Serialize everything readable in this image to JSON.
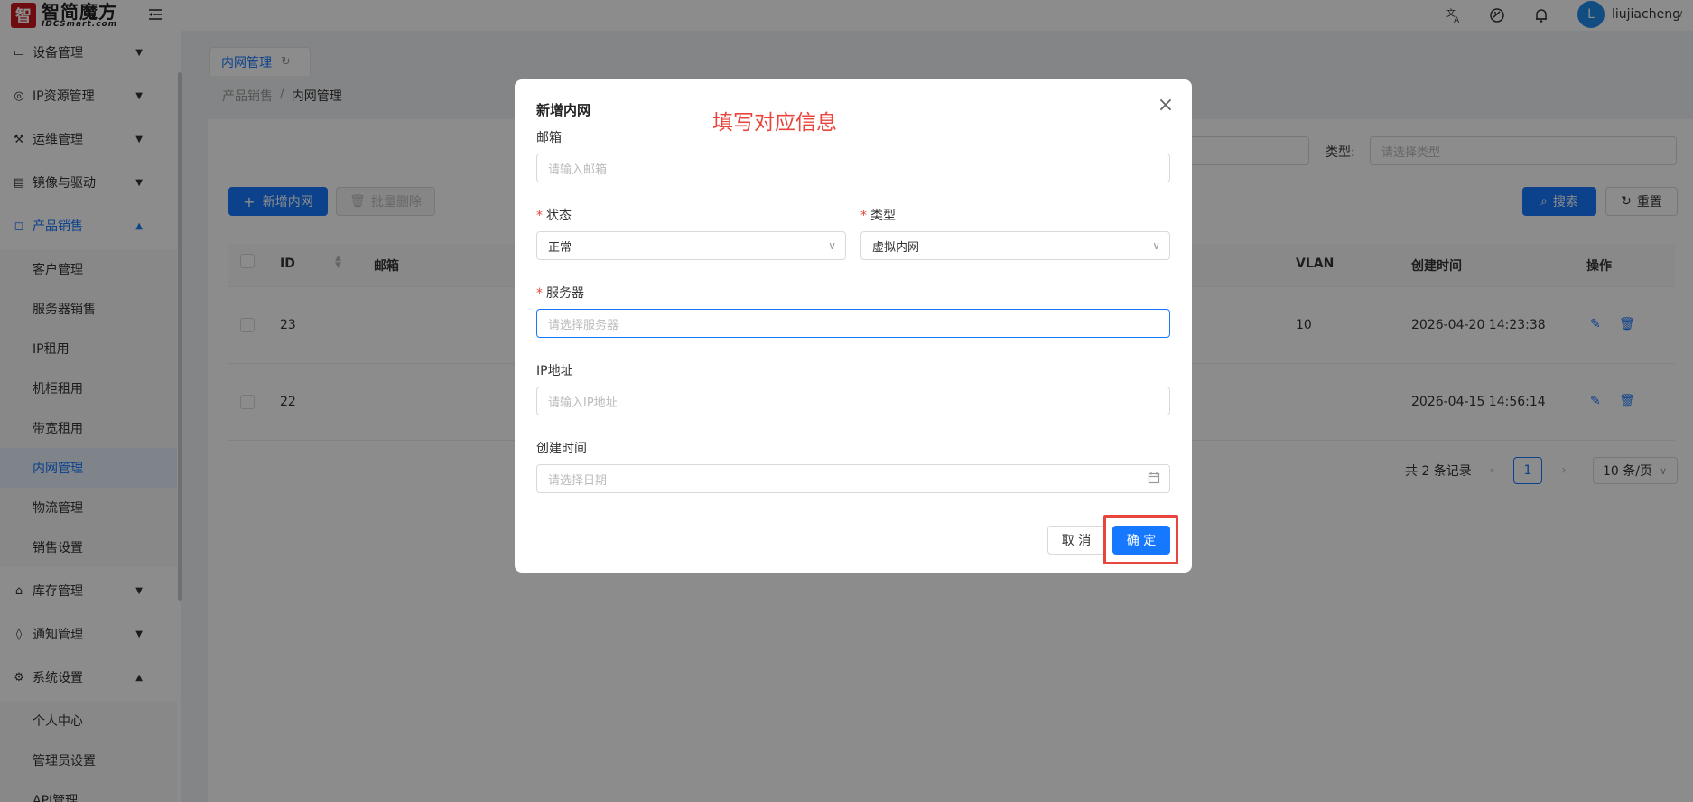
{
  "logo": {
    "mark": "智",
    "cn": "智简魔方",
    "en": "IDCSmart.com"
  },
  "header": {
    "avatar_letter": "L",
    "username": "liujiacheng"
  },
  "sidebar": {
    "items": [
      {
        "label": "设备管理"
      },
      {
        "label": "IP资源管理"
      },
      {
        "label": "运维管理"
      },
      {
        "label": "镜像与驱动"
      },
      {
        "label": "产品销售"
      },
      {
        "label": "库存管理"
      },
      {
        "label": "通知管理"
      },
      {
        "label": "系统设置"
      }
    ],
    "product_sub": [
      "客户管理",
      "服务器销售",
      "IP租用",
      "机柜租用",
      "带宽租用",
      "内网管理",
      "物流管理",
      "销售设置"
    ],
    "system_sub": [
      "个人中心",
      "管理员设置",
      "API管理"
    ]
  },
  "tab": {
    "label": "内网管理"
  },
  "breadcrumb": {
    "parent": "产品销售",
    "sep": "/",
    "current": "内网管理"
  },
  "filters": {
    "type_label": "类型:",
    "type_placeholder": "请选择类型",
    "search": "搜索",
    "reset": "重置"
  },
  "toolbar": {
    "add": "新增内网",
    "batch_delete": "批量删除"
  },
  "table": {
    "headers": {
      "id": "ID",
      "email": "邮箱",
      "vlan": "VLAN",
      "created": "创建时间",
      "ops": "操作"
    },
    "rows": [
      {
        "id": "23",
        "vlan": "10",
        "created": "2026-04-20 14:23:38"
      },
      {
        "id": "22",
        "vlan": "",
        "created": "2026-04-15 14:56:14"
      }
    ]
  },
  "pagination": {
    "total": "共 2 条记录",
    "page": "1",
    "page_size": "10 条/页"
  },
  "modal": {
    "title": "新增内网",
    "annotation": "填写对应信息",
    "email_label": "邮箱",
    "email_placeholder": "请输入邮箱",
    "status_label": "状态",
    "status_value": "正常",
    "type_label": "类型",
    "type_value": "虚拟内网",
    "server_label": "服务器",
    "server_placeholder": "请选择服务器",
    "ip_label": "IP地址",
    "ip_placeholder": "请输入IP地址",
    "time_label": "创建时间",
    "time_placeholder": "请选择日期",
    "cancel": "取 消",
    "confirm": "确 定"
  },
  "colors": {
    "primary": "#1677ff",
    "annotation": "#e8453c",
    "brand": "#c8171e"
  }
}
